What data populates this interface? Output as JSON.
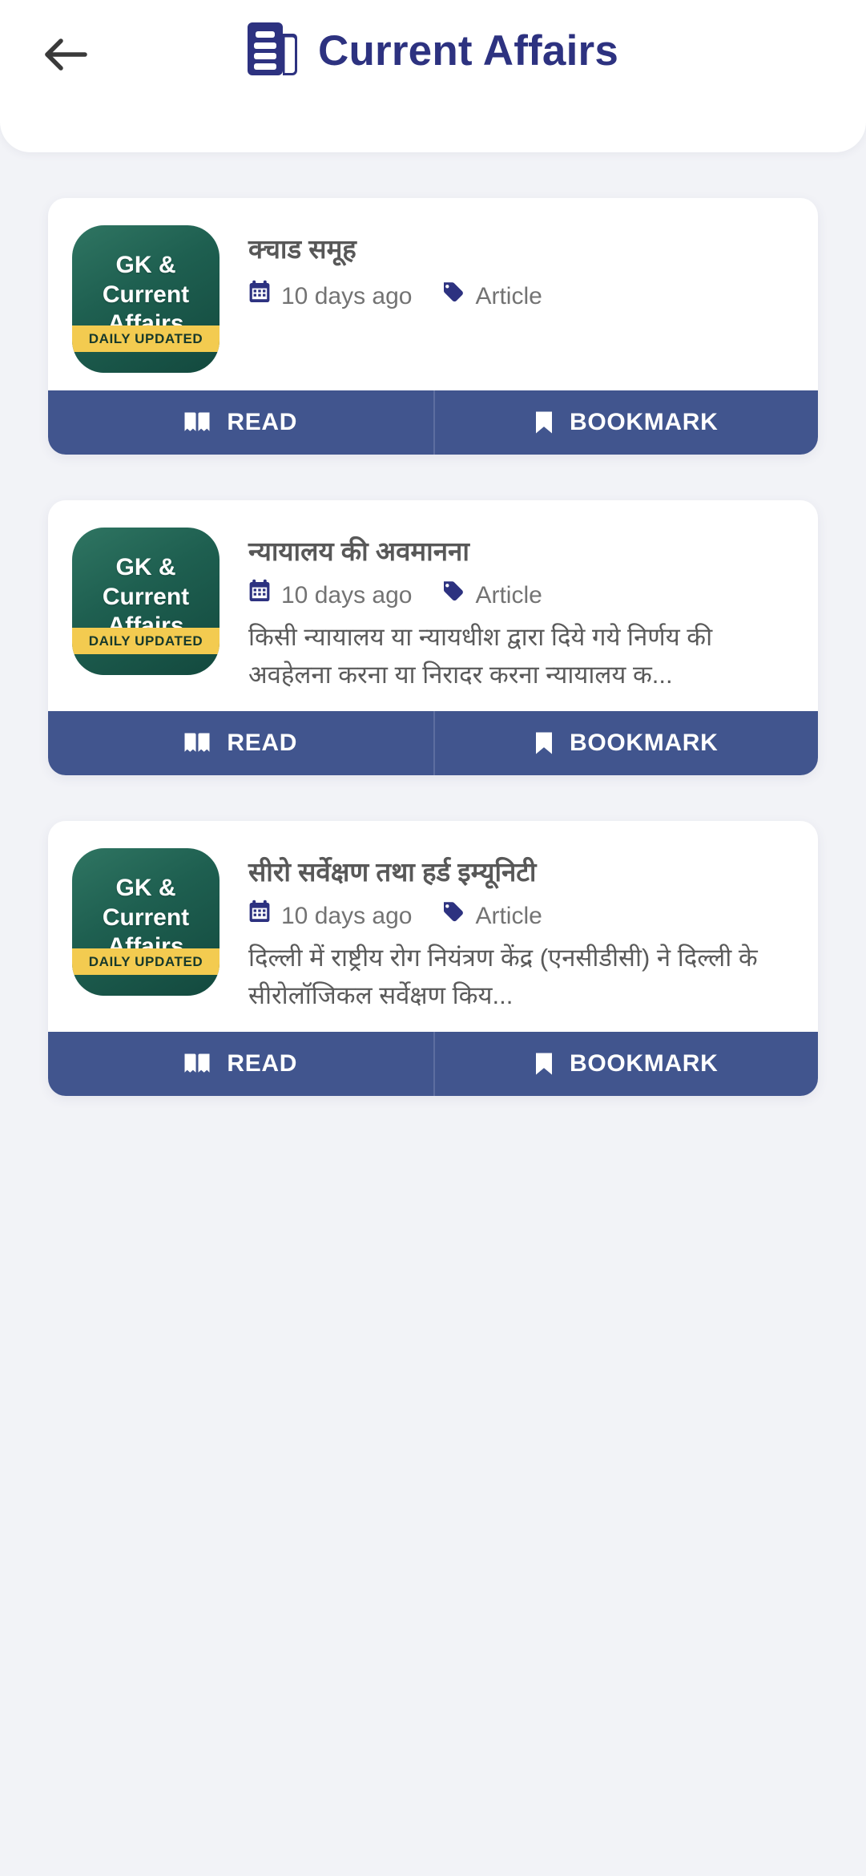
{
  "header": {
    "back_icon": "arrow-left-icon",
    "brand_icon": "newspaper-icon",
    "title": "Current Affairs",
    "title_color": "#2d3280"
  },
  "theme": {
    "page_background": "#f2f3f7",
    "card_background": "#ffffff",
    "action_bar": "#41558e",
    "thumb_green_dark": "#13493e",
    "thumb_green_light": "#2f7562",
    "thumb_band_yellow": "#f3cb50",
    "icon_navy": "#2d3280",
    "title_text": "#585858",
    "meta_text": "#737373"
  },
  "thumbnail": {
    "line1": "GK &",
    "line2": "Current",
    "line3": "Affairs",
    "badge": "DAILY UPDATED"
  },
  "actions": {
    "read_label": "READ",
    "read_icon": "book-open-icon",
    "bookmark_label": "BOOKMARK",
    "bookmark_icon": "bookmark-icon"
  },
  "icons": {
    "calendar": "calendar-icon",
    "tag": "tag-icon"
  },
  "cards": [
    {
      "title": "क्चाड समूह",
      "date": "10 days ago",
      "category": "Article",
      "excerpt": ""
    },
    {
      "title": "न्यायालय की अवमानना",
      "date": "10 days ago",
      "category": "Article",
      "excerpt": "किसी न्यायालय या न्यायधीश द्वारा दिये गये निर्णय की अवहेलना करना या निरादर करना न्यायालय क..."
    },
    {
      "title": "सीरो सर्वेक्षण तथा हर्ड इम्यूनिटी",
      "date": "10 days ago",
      "category": "Article",
      "excerpt": "दिल्ली में राष्ट्रीय रोग नियंत्रण केंद्र (एनसीडीसी) ने दिल्ली के सीरोलॉजिकल सर्वेक्षण किय..."
    }
  ]
}
